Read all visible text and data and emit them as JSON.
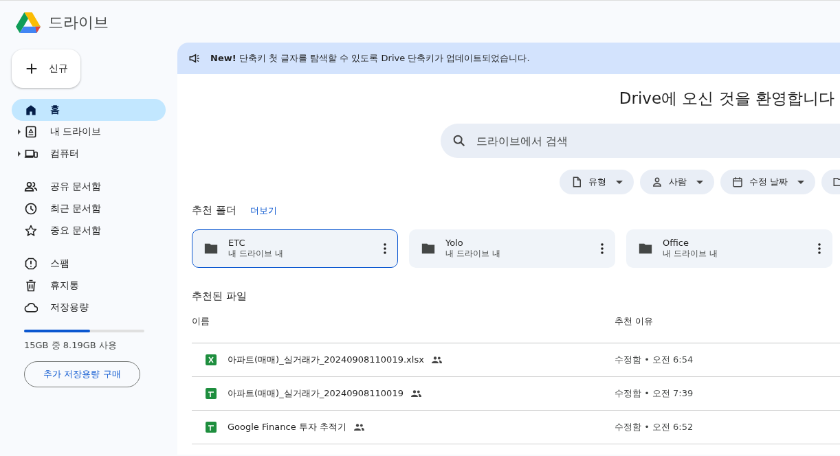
{
  "app": {
    "title": "드라이브"
  },
  "new_button": {
    "label": "신규"
  },
  "sidebar": {
    "groups": [
      {
        "items": [
          {
            "label": "홈",
            "selected": true,
            "expandable": false
          },
          {
            "label": "내 드라이브",
            "selected": false,
            "expandable": true
          },
          {
            "label": "컴퓨터",
            "selected": false,
            "expandable": true
          }
        ]
      },
      {
        "items": [
          {
            "label": "공유 문서함",
            "selected": false,
            "expandable": false
          },
          {
            "label": "최근 문서함",
            "selected": false,
            "expandable": false
          },
          {
            "label": "중요 문서함",
            "selected": false,
            "expandable": false
          }
        ]
      },
      {
        "items": [
          {
            "label": "스팸",
            "selected": false,
            "expandable": false
          },
          {
            "label": "휴지통",
            "selected": false,
            "expandable": false
          },
          {
            "label": "저장용량",
            "selected": false,
            "expandable": false
          }
        ]
      }
    ]
  },
  "storage": {
    "level": 0.546,
    "usage": "15GB 중 8.19GB 사용",
    "buy_button": "추가 저장용량 구매"
  },
  "banner": {
    "text": "**New!** 단축키 첫 글자를 탐색할 수 있도록 Drive 단축키가 업데이트되었습니다."
  },
  "welcome_title": "Drive에 오신 것을 환영합니다",
  "search": {
    "placeholder": "드라이브에서 검색"
  },
  "filters": [
    {
      "label": "유형"
    },
    {
      "label": "사람"
    },
    {
      "label": "수정 날짜"
    }
  ],
  "suggested_folders": {
    "title": "추천 폴더",
    "more_link": "더보기",
    "folders": [
      {
        "name": "ETC",
        "location": "내 드라이브 내",
        "selected": true
      },
      {
        "name": "Yolo",
        "location": "내 드라이브 내",
        "selected": false
      },
      {
        "name": "Office",
        "location": "내 드라이브 내",
        "selected": false
      }
    ]
  },
  "suggested_files": {
    "title": "추천된 파일",
    "columns": [
      "이름",
      "추천 이유"
    ],
    "rows": [
      {
        "name": "아파트(매매)_실거래가_20240908110019.xlsx",
        "kind": "excel",
        "shared": true,
        "reason": "수정함 • 오전 6:54"
      },
      {
        "name": "아파트(매매)_실거래가_20240908110019",
        "kind": "sheets",
        "shared": true,
        "reason": "수정함 • 오전 7:39"
      },
      {
        "name": "Google Finance 투자 추적기",
        "kind": "sheets",
        "shared": true,
        "reason": "수정함 • 오전 6:52"
      }
    ]
  }
}
